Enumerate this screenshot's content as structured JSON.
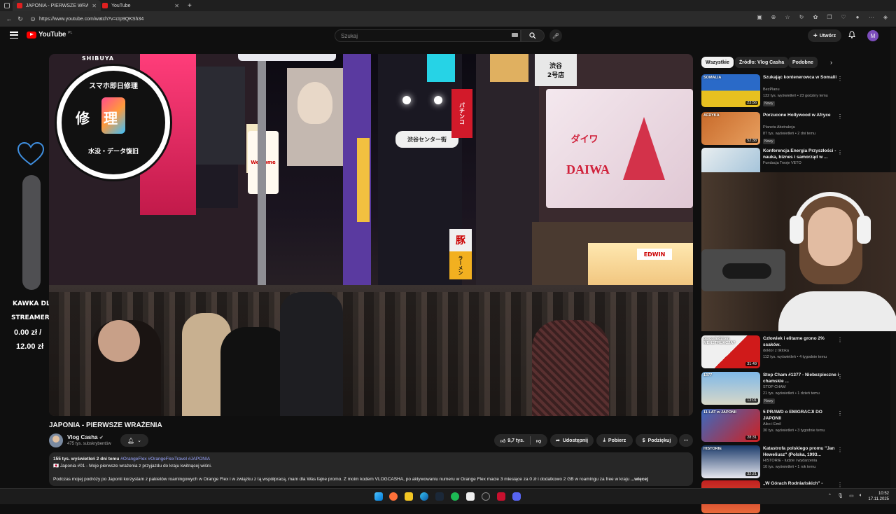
{
  "browser": {
    "tabs": [
      {
        "title": "JAPONIA - PIERWSZE WRAŻENIA"
      },
      {
        "title": "YouTube"
      }
    ],
    "url": "https://www.youtube.com/watch?v=cIp9QKSh34"
  },
  "header": {
    "logo_text": "YouTube",
    "logo_region": "PL",
    "search_placeholder": "Szukaj",
    "create_label": "Utwórz",
    "avatar_letter": "M"
  },
  "overlay": {
    "goal_title_1": "KAWKA DLA",
    "goal_title_2": "STREAMERKI",
    "goal_current": "0.00 zł /",
    "goal_target": "12.00 zł",
    "goal_progress": 0
  },
  "scene": {
    "badge_top": "SHIBUYA",
    "badge_jp_top": "スマホ即日修理",
    "badge_jp_mid": "修　理",
    "badge_jp_bottom": "水没・データ復旧",
    "daiwa_jp": "ダイワ",
    "daiwa": "DAIWA",
    "sign_welcome": "Welcome",
    "sign_shibuya": "渋谷\n2号店",
    "sign_center": "渋谷センター街",
    "sign_edwin": "EDWIN",
    "sign_pachinko": "パチンコ",
    "sign_kanji": "豚",
    "sign_ramen": "ラーメン"
  },
  "video": {
    "title": "JAPONIA - PIERWSZE WRAŻENIA",
    "channel": "Vlog Casha",
    "subscribers": "475 tys. subskrybentów",
    "likes": "9,7 tys.",
    "share": "Udostępnij",
    "download": "Pobierz",
    "thanks": "Podziękuj",
    "views_date": "155 tys. wyświetleń  2 dni temu",
    "tags": "#OrangeFlex #OrangeFlexTravel #JAPONIA",
    "desc_line1": "🇯🇵 Japonia #01 - Moje pierwsze wrażenia z przyjazdu do kraju kwitnącej wiśni.",
    "desc_line2": "Podczas mojej podróży po Japonii korzystam z pakietów roamingowych w Orange Flex i w związku z tą współpracą, mam dla Was fajne promo. Z moim kodem VLOGCASHA, po aktywowaniu numeru w Orange Flex macie 3 miesiące za 0 zł i dodatkowo 2 GB w roamingu za free w kraju",
    "more": "...więcej"
  },
  "chips": [
    "Wszystkie",
    "Źródło: Vlog Casha",
    "Podobne"
  ],
  "recommendations": [
    {
      "title": "Szukając kontenerowca w Somalii",
      "channel": "BezPlanu",
      "meta": "132 tys. wyświetleń • 23 godziny temu",
      "badge": "Nowy",
      "duration": "23:56",
      "thumb": "somalia",
      "thumb_text": "SOMALIA"
    },
    {
      "title": "Porzucone Hollywood w Afryce",
      "channel": "Planeta Abstrakcja",
      "meta": "87 tys. wyświetleń • 2 dni temu",
      "badge": "Nowy",
      "duration": "52:38",
      "thumb": "afryka",
      "thumb_text": "AFRYKA"
    },
    {
      "title": "Konferencja Energia Przyszłości - nauka, biznes i samorząd w ...",
      "channel": "Fundacja Twoje VETO",
      "meta": "",
      "badge": "",
      "duration": "",
      "thumb": "konf",
      "thumb_text": ""
    },
    {
      "title": "Człowiek i elitarne grono 2% ssaków.",
      "channel": "doktor z tiktoka",
      "meta": "112 tys. wyświetleń • 4 tygodnie temu",
      "badge": "",
      "duration": "31:49",
      "thumb": "doktor",
      "thumb_text": "po co ludziom MENSTRUACJA?"
    },
    {
      "title": "Stop Cham #1377 - Niebezpieczne i chamskie ...",
      "channel": "STOP CHAM",
      "meta": "21 tys. wyświetleń • 1 dzień temu",
      "badge": "Nowy",
      "duration": "13:01",
      "thumb": "stopcham",
      "thumb_text": "1377"
    },
    {
      "title": "5 PRAWD o EMIGRACJI DO JAPONII",
      "channel": "Aiko i Emil",
      "meta": "30 tys. wyświetleń • 3 tygodnie temu",
      "badge": "",
      "duration": "28:31",
      "thumb": "aiko",
      "thumb_text": "11 LAT w JAPONII"
    },
    {
      "title": "Katastrofa polskiego promu \"Jan Heweliusz\" (Polska, 1993...",
      "channel": "HISTORIE - ludzie i wydarzenia",
      "meta": "10 tys. wyświetleń • 1 rok temu",
      "badge": "",
      "duration": "32:21",
      "thumb": "prom",
      "thumb_text": "HISTORIE"
    },
    {
      "title": "„W Górach Rodniańskich\" -",
      "channel": "",
      "meta": "",
      "badge": "",
      "duration": "",
      "thumb": "gory",
      "thumb_text": ""
    }
  ],
  "taskbar": {
    "time": "10:52",
    "date": "17.11.2025"
  }
}
